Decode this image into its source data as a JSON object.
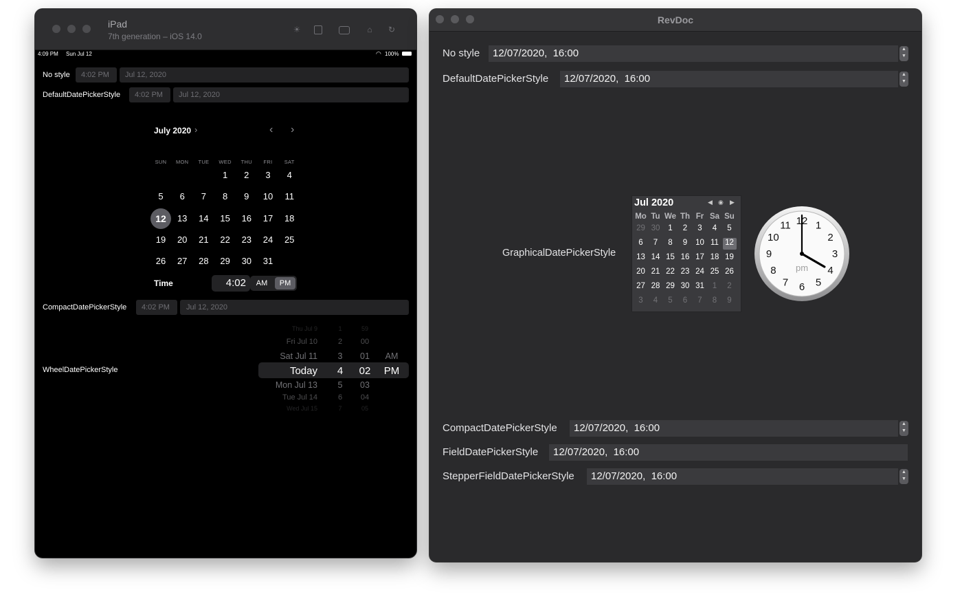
{
  "simulator": {
    "device": "iPad",
    "subtitle": "7th generation – iOS 14.0",
    "status": {
      "time": "4:09 PM",
      "date": "Sun Jul 12",
      "battery": "100%"
    },
    "rows": {
      "no_style": {
        "label": "No style",
        "time": "4:02 PM",
        "date": "Jul 12, 2020"
      },
      "default": {
        "label": "DefaultDatePickerStyle",
        "time": "4:02 PM",
        "date": "Jul 12, 2020"
      },
      "compact": {
        "label": "CompactDatePickerStyle",
        "time": "4:02 PM",
        "date": "Jul 12, 2020"
      },
      "wheel": {
        "label": "WheelDatePickerStyle"
      }
    },
    "calendar": {
      "month": "July 2020",
      "weekdays": [
        "SUN",
        "MON",
        "TUE",
        "WED",
        "THU",
        "FRI",
        "SAT"
      ],
      "weeks": [
        [
          "",
          "",
          "",
          "1",
          "2",
          "3",
          "4"
        ],
        [
          "5",
          "6",
          "7",
          "8",
          "9",
          "10",
          "11"
        ],
        [
          "12",
          "13",
          "14",
          "15",
          "16",
          "17",
          "18"
        ],
        [
          "19",
          "20",
          "21",
          "22",
          "23",
          "24",
          "25"
        ],
        [
          "26",
          "27",
          "28",
          "29",
          "30",
          "31",
          ""
        ]
      ],
      "selected": "12",
      "time_label": "Time",
      "time_value": "4:02",
      "am": "AM",
      "pm": "PM"
    },
    "wheel": {
      "dates": [
        "Thu Jul 9",
        "Fri Jul 10",
        "Sat Jul 11",
        "Today",
        "Mon Jul 13",
        "Tue Jul 14",
        "Wed Jul 15"
      ],
      "hours": [
        "1",
        "2",
        "3",
        "4",
        "5",
        "6",
        "7"
      ],
      "minutes": [
        "59",
        "00",
        "01",
        "02",
        "03",
        "04",
        "05"
      ],
      "ampm": [
        "AM",
        "PM"
      ]
    }
  },
  "mac": {
    "title": "RevDoc",
    "rows": {
      "no_style": {
        "label": "No style",
        "value": "12/07/2020,  16:00"
      },
      "default": {
        "label": "DefaultDatePickerStyle",
        "value": "12/07/2020,  16:00"
      },
      "graphical": {
        "label": "GraphicalDatePickerStyle"
      },
      "compact": {
        "label": "CompactDatePickerStyle",
        "value": "12/07/2020,  16:00"
      },
      "field": {
        "label": "FieldDatePickerStyle",
        "value": "12/07/2020,  16:00"
      },
      "stepper_field": {
        "label": "StepperFieldDatePickerStyle",
        "value": "12/07/2020,  16:00"
      }
    },
    "calendar": {
      "month": "Jul 2020",
      "weekdays": [
        "Mo",
        "Tu",
        "We",
        "Th",
        "Fr",
        "Sa",
        "Su"
      ],
      "weeks": [
        [
          "29",
          "30",
          "1",
          "2",
          "3",
          "4",
          "5"
        ],
        [
          "6",
          "7",
          "8",
          "9",
          "10",
          "11",
          "12"
        ],
        [
          "13",
          "14",
          "15",
          "16",
          "17",
          "18",
          "19"
        ],
        [
          "20",
          "21",
          "22",
          "23",
          "24",
          "25",
          "26"
        ],
        [
          "27",
          "28",
          "29",
          "30",
          "31",
          "1",
          "2"
        ],
        [
          "3",
          "4",
          "5",
          "6",
          "7",
          "8",
          "9"
        ]
      ],
      "selected": "12"
    },
    "clock": {
      "numbers": [
        "12",
        "1",
        "2",
        "3",
        "4",
        "5",
        "6",
        "7",
        "8",
        "9",
        "10",
        "11"
      ],
      "meridiem": "pm",
      "hour": 4,
      "minute": 0
    }
  }
}
